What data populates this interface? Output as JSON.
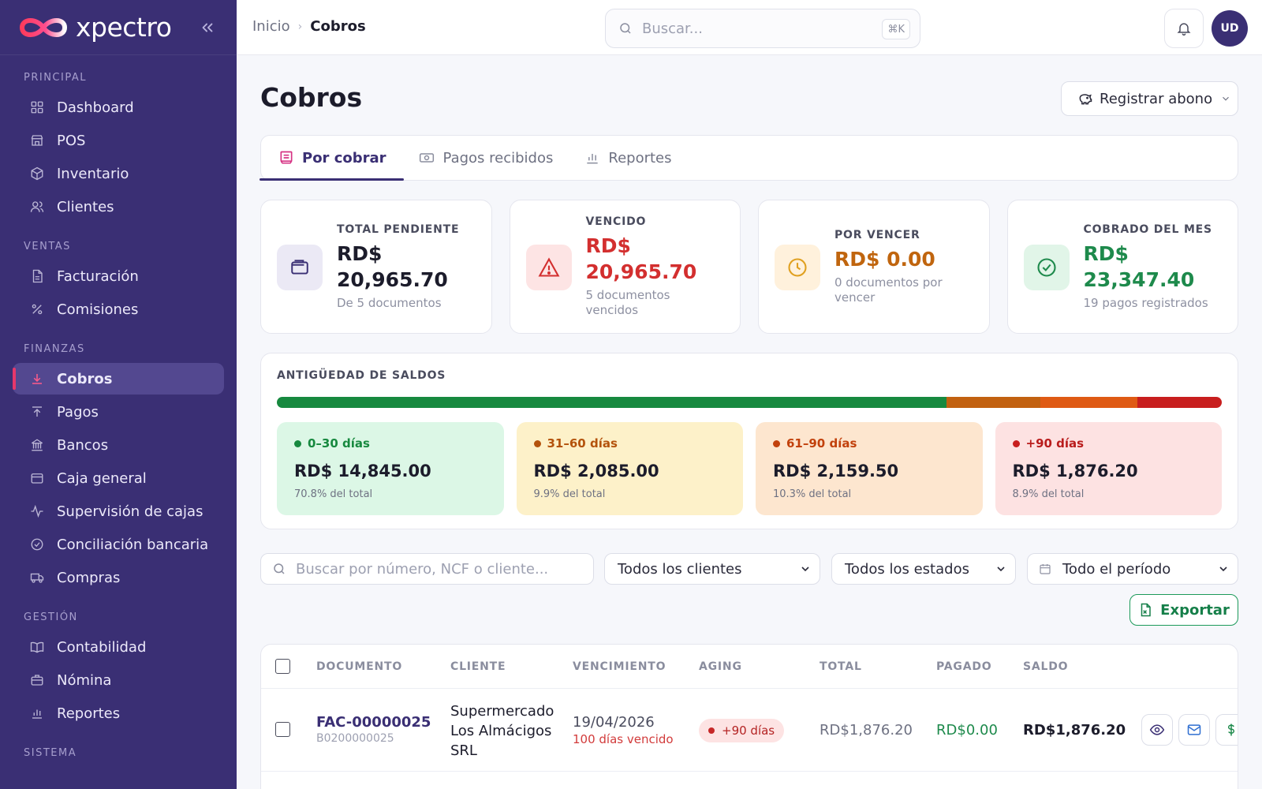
{
  "app": {
    "brand": "xpectro"
  },
  "sidebar": {
    "sections": [
      {
        "title": "PRINCIPAL",
        "items": [
          {
            "label": "Dashboard",
            "icon": "grid-icon"
          },
          {
            "label": "POS",
            "icon": "store-icon"
          },
          {
            "label": "Inventario",
            "icon": "box-icon"
          },
          {
            "label": "Clientes",
            "icon": "users-icon"
          }
        ]
      },
      {
        "title": "VENTAS",
        "items": [
          {
            "label": "Facturación",
            "icon": "document-icon"
          },
          {
            "label": "Comisiones",
            "icon": "percent-icon"
          }
        ]
      },
      {
        "title": "FINANZAS",
        "items": [
          {
            "label": "Cobros",
            "icon": "download-icon",
            "active": true
          },
          {
            "label": "Pagos",
            "icon": "upload-icon"
          },
          {
            "label": "Bancos",
            "icon": "bank-icon"
          },
          {
            "label": "Caja general",
            "icon": "cash-register-icon"
          },
          {
            "label": "Supervisión de cajas",
            "icon": "activity-icon"
          },
          {
            "label": "Conciliación bancaria",
            "icon": "check-circle-icon"
          },
          {
            "label": "Compras",
            "icon": "truck-icon"
          }
        ]
      },
      {
        "title": "GESTIÓN",
        "items": [
          {
            "label": "Contabilidad",
            "icon": "book-icon"
          },
          {
            "label": "Nómina",
            "icon": "briefcase-icon"
          },
          {
            "label": "Reportes",
            "icon": "bar-chart-icon"
          }
        ]
      },
      {
        "title": "SISTEMA",
        "items": []
      }
    ]
  },
  "topbar": {
    "breadcrumb_home": "Inicio",
    "breadcrumb_current": "Cobros",
    "search_placeholder": "Buscar...",
    "search_shortcut": "⌘K",
    "avatar_initials": "UD"
  },
  "page": {
    "title": "Cobros",
    "register_button": "Registrar abono",
    "tabs": [
      {
        "label": "Por cobrar",
        "active": true,
        "icon": "receipt-icon"
      },
      {
        "label": "Pagos recibidos",
        "active": false,
        "icon": "banknote-icon"
      },
      {
        "label": "Reportes",
        "active": false,
        "icon": "bar-chart-icon"
      }
    ]
  },
  "stats": [
    {
      "label": "TOTAL PENDIENTE",
      "value_line1": "RD$",
      "value_line2": "20,965.70",
      "sub_line1": "De 5 documentos",
      "sub_line2": "",
      "color": "#1c1c2b",
      "icon_bg": "#ebe9f5",
      "icon": "wallet-icon"
    },
    {
      "label": "VENCIDO",
      "value_line1": "RD$",
      "value_line2": "20,965.70",
      "sub_line1": "5 documentos",
      "sub_line2": "vencidos",
      "color": "#d32f2f",
      "icon_bg": "#fde4e4",
      "icon": "alert-triangle-icon"
    },
    {
      "label": "POR VENCER",
      "value_line1": "RD$ 0.00",
      "value_line2": "",
      "sub_line1": "0 documentos por",
      "sub_line2": "vencer",
      "color": "#c0650e",
      "icon_bg": "#fff1dc",
      "icon": "clock-icon"
    },
    {
      "label": "COBRADO DEL MES",
      "value_line1": "RD$",
      "value_line2": "23,347.40",
      "sub_line1": "19 pagos registrados",
      "sub_line2": "",
      "color": "#1e8a4c",
      "icon_bg": "#e1f5e8",
      "icon": "check-circle-icon"
    }
  ],
  "aging": {
    "title": "ANTIGÜEDAD DE SALDOS",
    "buckets": [
      {
        "label": "0–30 días",
        "amount": "RD$ 14,845.00",
        "pct_text": "70.8% del total",
        "share": 0.708,
        "bar_color": "#17893f",
        "bg": "#dcf7e6",
        "text_color": "#17893f"
      },
      {
        "label": "31–60 días",
        "amount": "RD$ 2,085.00",
        "pct_text": "9.9% del total",
        "share": 0.099,
        "bar_color": "#c26110",
        "bg": "#fdf1c9",
        "text_color": "#b4530c"
      },
      {
        "label": "61–90 días",
        "amount": "RD$ 2,159.50",
        "pct_text": "10.3% del total",
        "share": 0.103,
        "bar_color": "#df5a14",
        "bg": "#fde6cf",
        "text_color": "#c2410c"
      },
      {
        "label": "+90 días",
        "amount": "RD$ 1,876.20",
        "pct_text": "8.9% del total",
        "share": 0.089,
        "bar_color": "#c81e1e",
        "bg": "#fde2e2",
        "text_color": "#b91c1c"
      }
    ]
  },
  "filters": {
    "search_placeholder": "Buscar por número, NCF o cliente...",
    "clients": "Todos los clientes",
    "status": "Todos los estados",
    "period": "Todo el período"
  },
  "export_button": "Exportar",
  "table": {
    "headers": [
      "DOCUMENTO",
      "CLIENTE",
      "VENCIMIENTO",
      "AGING",
      "TOTAL",
      "PAGADO",
      "SALDO"
    ],
    "rows": [
      {
        "doc": "FAC-00000025",
        "ncf": "B0200000025",
        "client_line1": "Supermercado",
        "client_line2": "Los Almácigos",
        "client_line3": "SRL",
        "due_date": "19/04/2026",
        "due_note": "100 días vencido",
        "aging": "+90 días",
        "total": "RD$1,876.20",
        "paid": "RD$0.00",
        "balance": "RD$1,876.20"
      }
    ]
  },
  "colors": {
    "primary": "#3a2f74",
    "accent": "#e6376b",
    "success": "#1e8a4c",
    "danger": "#d32f2f"
  }
}
